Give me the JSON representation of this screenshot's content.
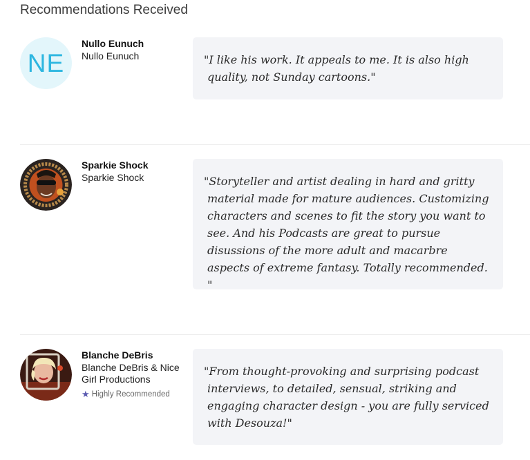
{
  "section": {
    "title": "Recommendations Received"
  },
  "recommendations": [
    {
      "name": "Nullo Eunuch",
      "subtitle": "Nullo Eunuch",
      "avatar_initials": "NE",
      "quote": "\"I like his work. It appeals to me. It is also high quality, not Sunday cartoons.\""
    },
    {
      "name": "Sparkie Shock",
      "subtitle": "Sparkie Shock",
      "quote": "\"Storyteller and artist dealing in hard and gritty material made for mature audiences. Customizing characters and scenes to fit the story you want to see. And his Podcasts are great to pursue disussions of the more adult and macarbre aspects of extreme fantasy. Totally recommended. \""
    },
    {
      "name": "Blanche DeBris",
      "subtitle": "Blanche DeBris & Nice Girl Productions",
      "badge": "Highly Recommended",
      "badge_icon": "star-icon",
      "quote": "\"From thought-provoking and surprising podcast interviews, to detailed, sensual, striking and engaging character design - you are fully serviced with Desouza!\""
    }
  ],
  "colors": {
    "quote_bg": "#f3f4f7",
    "initials_bg": "#e3f6fb",
    "initials_text": "#2cb6e0",
    "badge_star": "#5a5ab0"
  }
}
